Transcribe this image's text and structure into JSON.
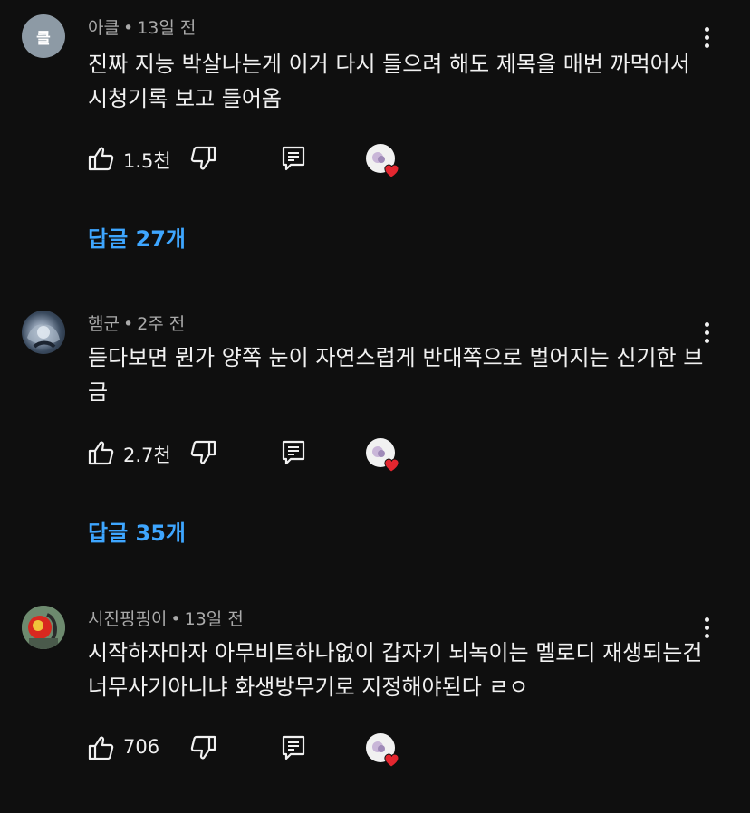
{
  "comments": [
    {
      "avatar_letter": "클",
      "author": "아클",
      "time": "13일 전",
      "text": "진짜 지능 박살나는게 이거 다시 들으려 해도 제목을 매번 까먹어서 시청기록 보고 들어옴",
      "likes": "1.5천",
      "replies": "답글 27개"
    },
    {
      "author": "햄군",
      "time": "2주 전",
      "text": "듣다보면 뭔가 양쪽 눈이 자연스럽게 반대쪽으로 벌어지는 신기한 브금",
      "likes": "2.7천",
      "replies": "답글 35개"
    },
    {
      "author": "시진핑핑이",
      "time": "13일 전",
      "text": "시작하자마자 아무비트하나없이 갑자기 뇌녹이는 멜로디 재생되는건 너무사기아니냐 화생방무기로 지정해야된다 ㄹㅇ",
      "likes": "706"
    }
  ],
  "meta_separator": "•",
  "colors": {
    "background": "#0f0f0f",
    "text": "#f1f1f1",
    "secondary": "#aaaaaa",
    "link": "#3ea6ff",
    "heart": "#e3262f"
  }
}
